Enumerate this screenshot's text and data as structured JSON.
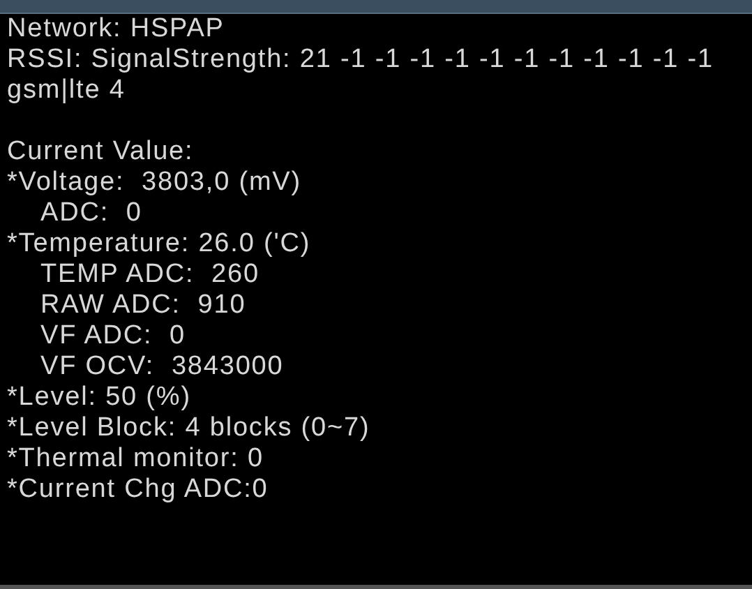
{
  "status_lines": [
    {
      "text": "Network: HSPAP",
      "kind": "line"
    },
    {
      "text": "RSSI: SignalStrength: 21 -1 -1 -1 -1 -1 -1 -1 -1 -1 -1 -1",
      "kind": "line"
    },
    {
      "text": "gsm|lte 4",
      "kind": "line"
    }
  ],
  "current_values": [
    {
      "text": "Current Value:",
      "kind": "line"
    },
    {
      "text": "*Voltage:  3803,0 (mV)",
      "kind": "line"
    },
    {
      "text": "ADC:  0",
      "kind": "sub"
    },
    {
      "text": "*Temperature: 26.0 ('C)",
      "kind": "line"
    },
    {
      "text": "TEMP ADC:  260",
      "kind": "sub"
    },
    {
      "text": "RAW ADC:  910",
      "kind": "sub"
    },
    {
      "text": "VF ADC:  0",
      "kind": "sub"
    },
    {
      "text": "VF OCV:  3843000",
      "kind": "sub"
    },
    {
      "text": "*Level: 50 (%)",
      "kind": "line"
    },
    {
      "text": "*Level Block: 4 blocks (0~7)",
      "kind": "line"
    },
    {
      "text": "*Thermal monitor: 0",
      "kind": "line"
    },
    {
      "text": "*Current Chg ADC:0",
      "kind": "line"
    }
  ]
}
